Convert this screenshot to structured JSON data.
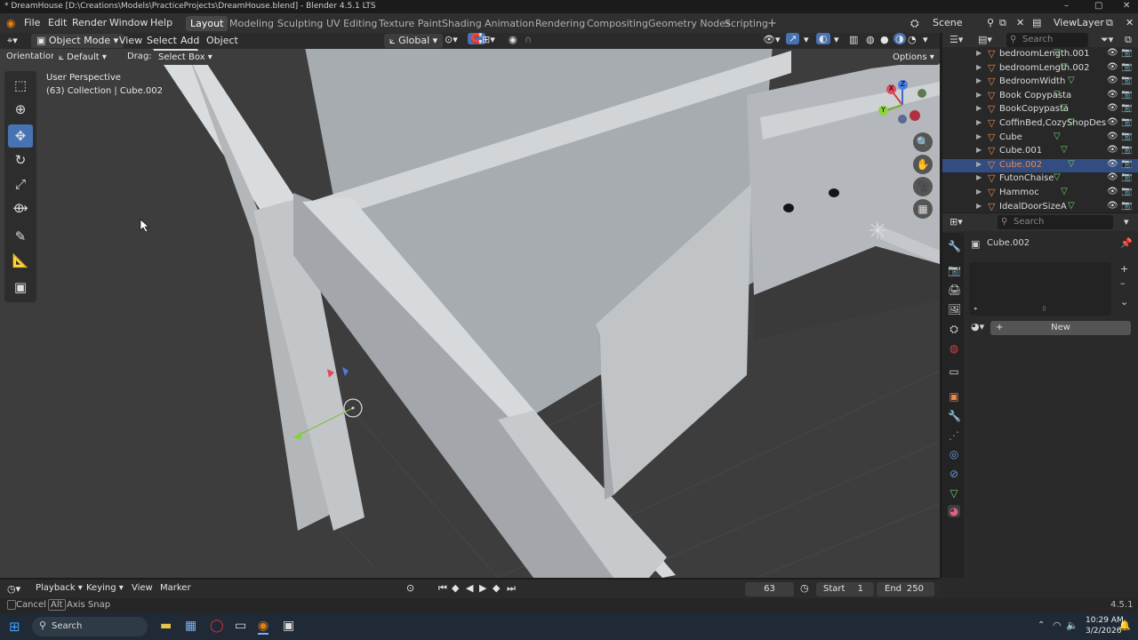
{
  "window": {
    "title": "* DreamHouse [D:\\Creations\\Models\\PracticeProjects\\DreamHouse.blend] - Blender 4.5.1 LTS"
  },
  "menu": [
    "File",
    "Edit",
    "Render",
    "Window",
    "Help"
  ],
  "workspaces": [
    "Layout",
    "Modeling",
    "Sculpting",
    "UV Editing",
    "Texture Paint",
    "Shading",
    "Animation",
    "Rendering",
    "Compositing",
    "Geometry Nodes",
    "Scripting"
  ],
  "workspace_add": "+",
  "scene": {
    "scene_name": "Scene",
    "view_layer": "ViewLayer"
  },
  "viewport_header": {
    "mode": "Object Mode",
    "view": "View",
    "select": "Select",
    "add": "Add",
    "object": "Object",
    "transform_orientation": "Global"
  },
  "tool_header": {
    "orientation_label": "Orientation:",
    "orientation_value": "Default",
    "drag_label": "Drag:",
    "drag_value": "Select Box",
    "options": "Options"
  },
  "viewport_info": {
    "perspective": "User Perspective",
    "collection": "(63) Collection | Cube.002"
  },
  "gizmo": {
    "x": "X",
    "y": "Y",
    "z": "Z"
  },
  "outliner": {
    "search_placeholder": "Search",
    "items": [
      {
        "name": "bedroomLength.001",
        "selected": false
      },
      {
        "name": "bedroomLength.002",
        "selected": false
      },
      {
        "name": "BedroomWidth",
        "selected": false
      },
      {
        "name": "Book Copypasta",
        "selected": false
      },
      {
        "name": "BookCopypasta",
        "selected": false
      },
      {
        "name": "CoffinBed,CozyShopDes",
        "selected": false
      },
      {
        "name": "Cube",
        "selected": false
      },
      {
        "name": "Cube.001",
        "selected": false
      },
      {
        "name": "Cube.002",
        "selected": true
      },
      {
        "name": "FutonChaise",
        "selected": false
      },
      {
        "name": "Hammoc",
        "selected": false
      },
      {
        "name": "IdealDoorSizeA",
        "selected": false
      }
    ]
  },
  "properties": {
    "search_placeholder": "Search",
    "object_name": "Cube.002",
    "new_button": "New"
  },
  "timeline": {
    "playback": "Playback",
    "keying": "Keying",
    "view": "View",
    "marker": "Marker",
    "current_frame": "63",
    "start_label": "Start",
    "start": "1",
    "end_label": "End",
    "end": "250"
  },
  "statusbar": {
    "cancel": "Cancel",
    "alt_key": "Alt",
    "axis_snap": "Axis Snap",
    "version": "4.5.1"
  },
  "taskbar": {
    "search": "Search",
    "time": "10:29 AM",
    "date": "3/2/2026"
  },
  "colors": {
    "accent": "#4772b3",
    "selected_row": "#334d80",
    "object_orange": "#e8884b",
    "mesh_green": "#6fcf6f"
  }
}
